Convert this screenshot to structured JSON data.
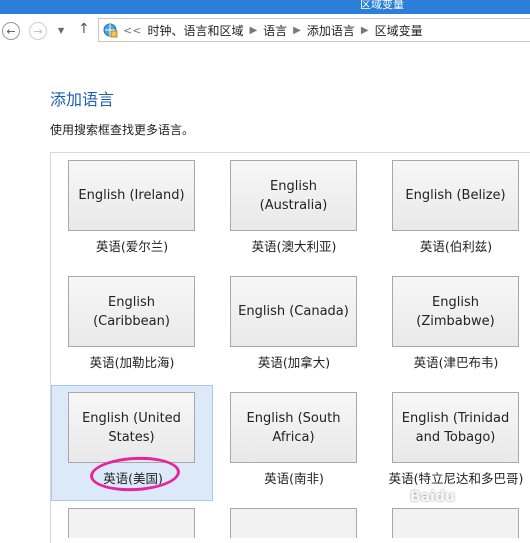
{
  "window": {
    "title": "区域变量"
  },
  "nav": {
    "back_icon": "back-arrow-icon",
    "forward_icon": "forward-arrow-icon",
    "up_icon": "up-arrow-icon"
  },
  "address": {
    "overflow": "<<",
    "crumbs": [
      "时钟、语言和区域",
      "语言",
      "添加语言",
      "区域变量"
    ]
  },
  "page": {
    "heading": "添加语言",
    "description": "使用搜索框查找更多语言。"
  },
  "languages": [
    {
      "button": "English (Ireland)",
      "caption": "英语(爱尔兰)",
      "selected": false
    },
    {
      "button": "English (Australia)",
      "caption": "英语(澳大利亚)",
      "selected": false
    },
    {
      "button": "English (Belize)",
      "caption": "英语(伯利兹)",
      "selected": false
    },
    {
      "button": "English (Caribbean)",
      "caption": "英语(加勒比海)",
      "selected": false
    },
    {
      "button": "English (Canada)",
      "caption": "英语(加拿大)",
      "selected": false
    },
    {
      "button": "English (Zimbabwe)",
      "caption": "英语(津巴布韦)",
      "selected": false
    },
    {
      "button": "English (United States)",
      "caption": "英语(美国)",
      "selected": true
    },
    {
      "button": "English (South Africa)",
      "caption": "英语(南非)",
      "selected": false
    },
    {
      "button": "English (Trinidad and Tobago)",
      "caption": "英语(特立尼达和多巴哥)",
      "selected": false
    }
  ],
  "colors": {
    "heading": "#1e5fb4",
    "selection": "#dbe9f9",
    "annotation_circle": "#e6249b"
  },
  "watermark": "Baidu"
}
